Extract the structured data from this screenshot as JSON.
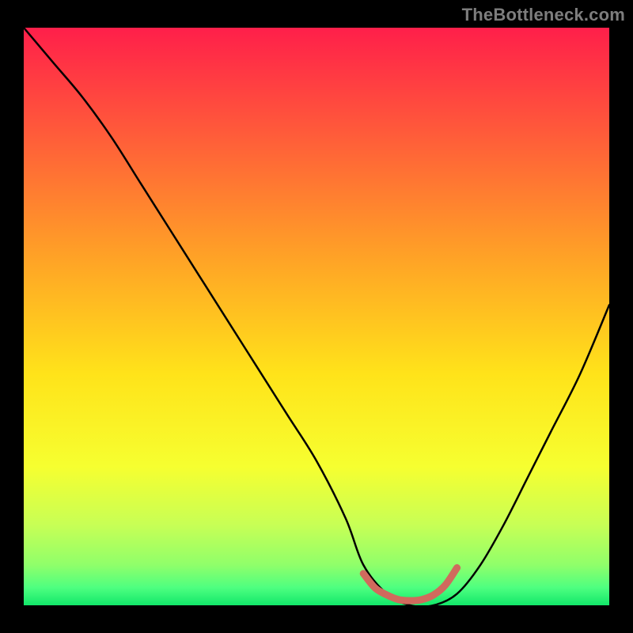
{
  "attribution": "TheBottleneck.com",
  "colors": {
    "bg": "#000000",
    "curve": "#000000",
    "marker": "#d06a5d",
    "marker_fill": "#d5866e",
    "gradient": [
      {
        "offset": 0.0,
        "color": "#ff1f4a"
      },
      {
        "offset": 0.18,
        "color": "#ff5a3a"
      },
      {
        "offset": 0.4,
        "color": "#ffa326"
      },
      {
        "offset": 0.6,
        "color": "#ffe31a"
      },
      {
        "offset": 0.76,
        "color": "#f6ff30"
      },
      {
        "offset": 0.86,
        "color": "#c8ff55"
      },
      {
        "offset": 0.93,
        "color": "#90ff6a"
      },
      {
        "offset": 0.97,
        "color": "#4dff80"
      },
      {
        "offset": 1.0,
        "color": "#12e76a"
      }
    ]
  },
  "chart_data": {
    "type": "line",
    "title": "",
    "xlabel": "",
    "ylabel": "",
    "xlim": [
      0,
      100
    ],
    "ylim": [
      0,
      100
    ],
    "series": [
      {
        "name": "curve",
        "x": [
          0,
          5,
          10,
          15,
          20,
          25,
          30,
          35,
          40,
          45,
          50,
          55,
          58,
          62,
          66,
          70,
          74,
          78,
          82,
          86,
          90,
          95,
          100
        ],
        "y": [
          100,
          94,
          88,
          81,
          73,
          65,
          57,
          49,
          41,
          33,
          25,
          15,
          7,
          2,
          0,
          0,
          2,
          7,
          14,
          22,
          30,
          40,
          52
        ]
      },
      {
        "name": "valley_marker",
        "x": [
          58,
          60,
          62,
          64,
          66,
          68,
          70,
          72,
          74
        ],
        "y": [
          5.5,
          3.0,
          1.8,
          1.0,
          0.8,
          1.0,
          1.8,
          3.5,
          6.5
        ]
      }
    ]
  }
}
